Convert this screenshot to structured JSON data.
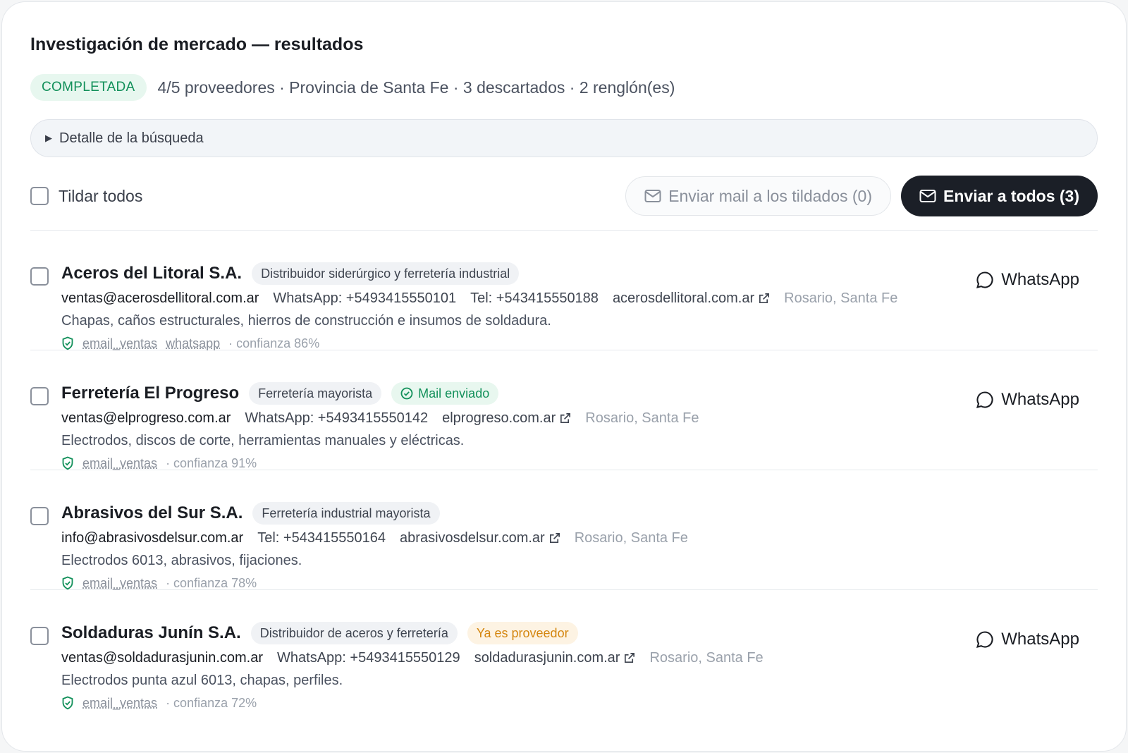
{
  "title": "Investigación de mercado — resultados",
  "status": {
    "badge": "COMPLETADA",
    "summary": "4/5 proveedores · Provincia de Santa Fe · 3 descartados · 2 renglón(es)"
  },
  "details_label": "Detalle de la búsqueda",
  "toolbar": {
    "select_all_label": "Tildar todos",
    "send_selected_label": "Enviar mail a los tildados (0)",
    "send_all_label": "Enviar a todos (3)"
  },
  "whatsapp_label": "WhatsApp",
  "colors": {
    "accent_green": "#12905a",
    "dark": "#1b1f27",
    "amber": "#d4860f"
  },
  "suppliers": [
    {
      "name": "Aceros del Litoral S.A.",
      "tag": "Distribuidor siderúrgico y ferretería industrial",
      "email": "ventas@acerosdellitoral.com.ar",
      "whatsapp": "WhatsApp: +5493415550101",
      "tel": "Tel: +543415550188",
      "website": "acerosdellitoral.com.ar",
      "location": "Rosario, Santa Fe",
      "description": "Chapas, caños estructurales, hierros de construcción e insumos de soldadura.",
      "sources": [
        "email_ventas",
        "whatsapp"
      ],
      "confidence": "· confianza 86%"
    },
    {
      "name": "Ferretería El Progreso",
      "tag": "Ferretería mayorista",
      "status_tag": "Mail enviado",
      "email": "ventas@elprogreso.com.ar",
      "whatsapp": "WhatsApp: +5493415550142",
      "website": "elprogreso.com.ar",
      "location": "Rosario, Santa Fe",
      "description": "Electrodos, discos de corte, herramientas manuales y eléctricas.",
      "sources": [
        "email_ventas"
      ],
      "confidence": "· confianza 91%"
    },
    {
      "name": "Abrasivos del Sur S.A.",
      "tag": "Ferretería industrial mayorista",
      "email": "info@abrasivosdelsur.com.ar",
      "tel": "Tel: +543415550164",
      "website": "abrasivosdelsur.com.ar",
      "location": "Rosario, Santa Fe",
      "description": "Electrodos 6013, abrasivos, fijaciones.",
      "sources": [
        "email_ventas"
      ],
      "confidence": "· confianza 78%"
    },
    {
      "name": "Soldaduras Junín S.A.",
      "tag": "Distribuidor de aceros y ferretería",
      "warn_tag": "Ya es proveedor",
      "email": "ventas@soldadurasjunin.com.ar",
      "whatsapp": "WhatsApp: +5493415550129",
      "website": "soldadurasjunin.com.ar",
      "location": "Rosario, Santa Fe",
      "description": "Electrodos punta azul 6013, chapas, perfiles.",
      "sources": [
        "email_ventas"
      ],
      "confidence": "· confianza 72%"
    }
  ]
}
